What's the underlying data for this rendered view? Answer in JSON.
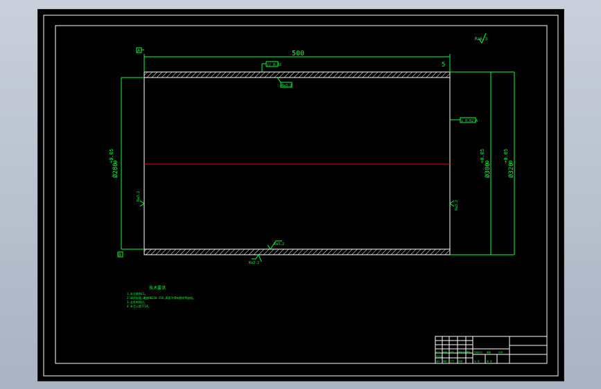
{
  "drawing": {
    "length_dim": "500",
    "tolerance_top": "5",
    "dia_left": "Ø280",
    "dia_left_tol_upper": "+0.05",
    "dia_left_tol_lower": "0",
    "dia_right_inner": "Ø300",
    "dia_right_inner_tol_upper": "+0.05",
    "dia_right_inner_tol_lower": "0",
    "dia_right_outer": "Ø320",
    "dia_right_outer_tol_upper": "+0.05",
    "dia_right_outer_tol_lower": "0",
    "datum_a": "A",
    "datum_b": "B",
    "fcf_top": "// 0.02",
    "fcf_under_top": "Ra3.2",
    "fcf_right": "⊥ 0.02 A",
    "rough_corner": "Ra6.3",
    "rough_left": "Ra3.2",
    "rough_right": "Ra3.2",
    "rough_bottom_top": "Ra3.2",
    "rough_bottom": "Ra3.2"
  },
  "notes": {
    "title": "技术要求",
    "lines": [
      "1.未注倒角C1。",
      "2.调质处理,硬度HB220-250,表面不得有裂纹等缺陷。",
      "3.去毛刺锐边。",
      "4.未注公差IT14。"
    ]
  },
  "title_block": {
    "cells": [
      "标记",
      "处数",
      "分区",
      "更改文件号",
      "签名",
      "年月日",
      "设计",
      "审核",
      "工艺",
      "批准",
      "阶段标记",
      "重量",
      "比例",
      "共 张",
      "第 张"
    ]
  },
  "colors": {
    "background": "#000000",
    "frame": "#ffffff",
    "dimension": "#00ff3c",
    "centerline": "#ff0000"
  }
}
